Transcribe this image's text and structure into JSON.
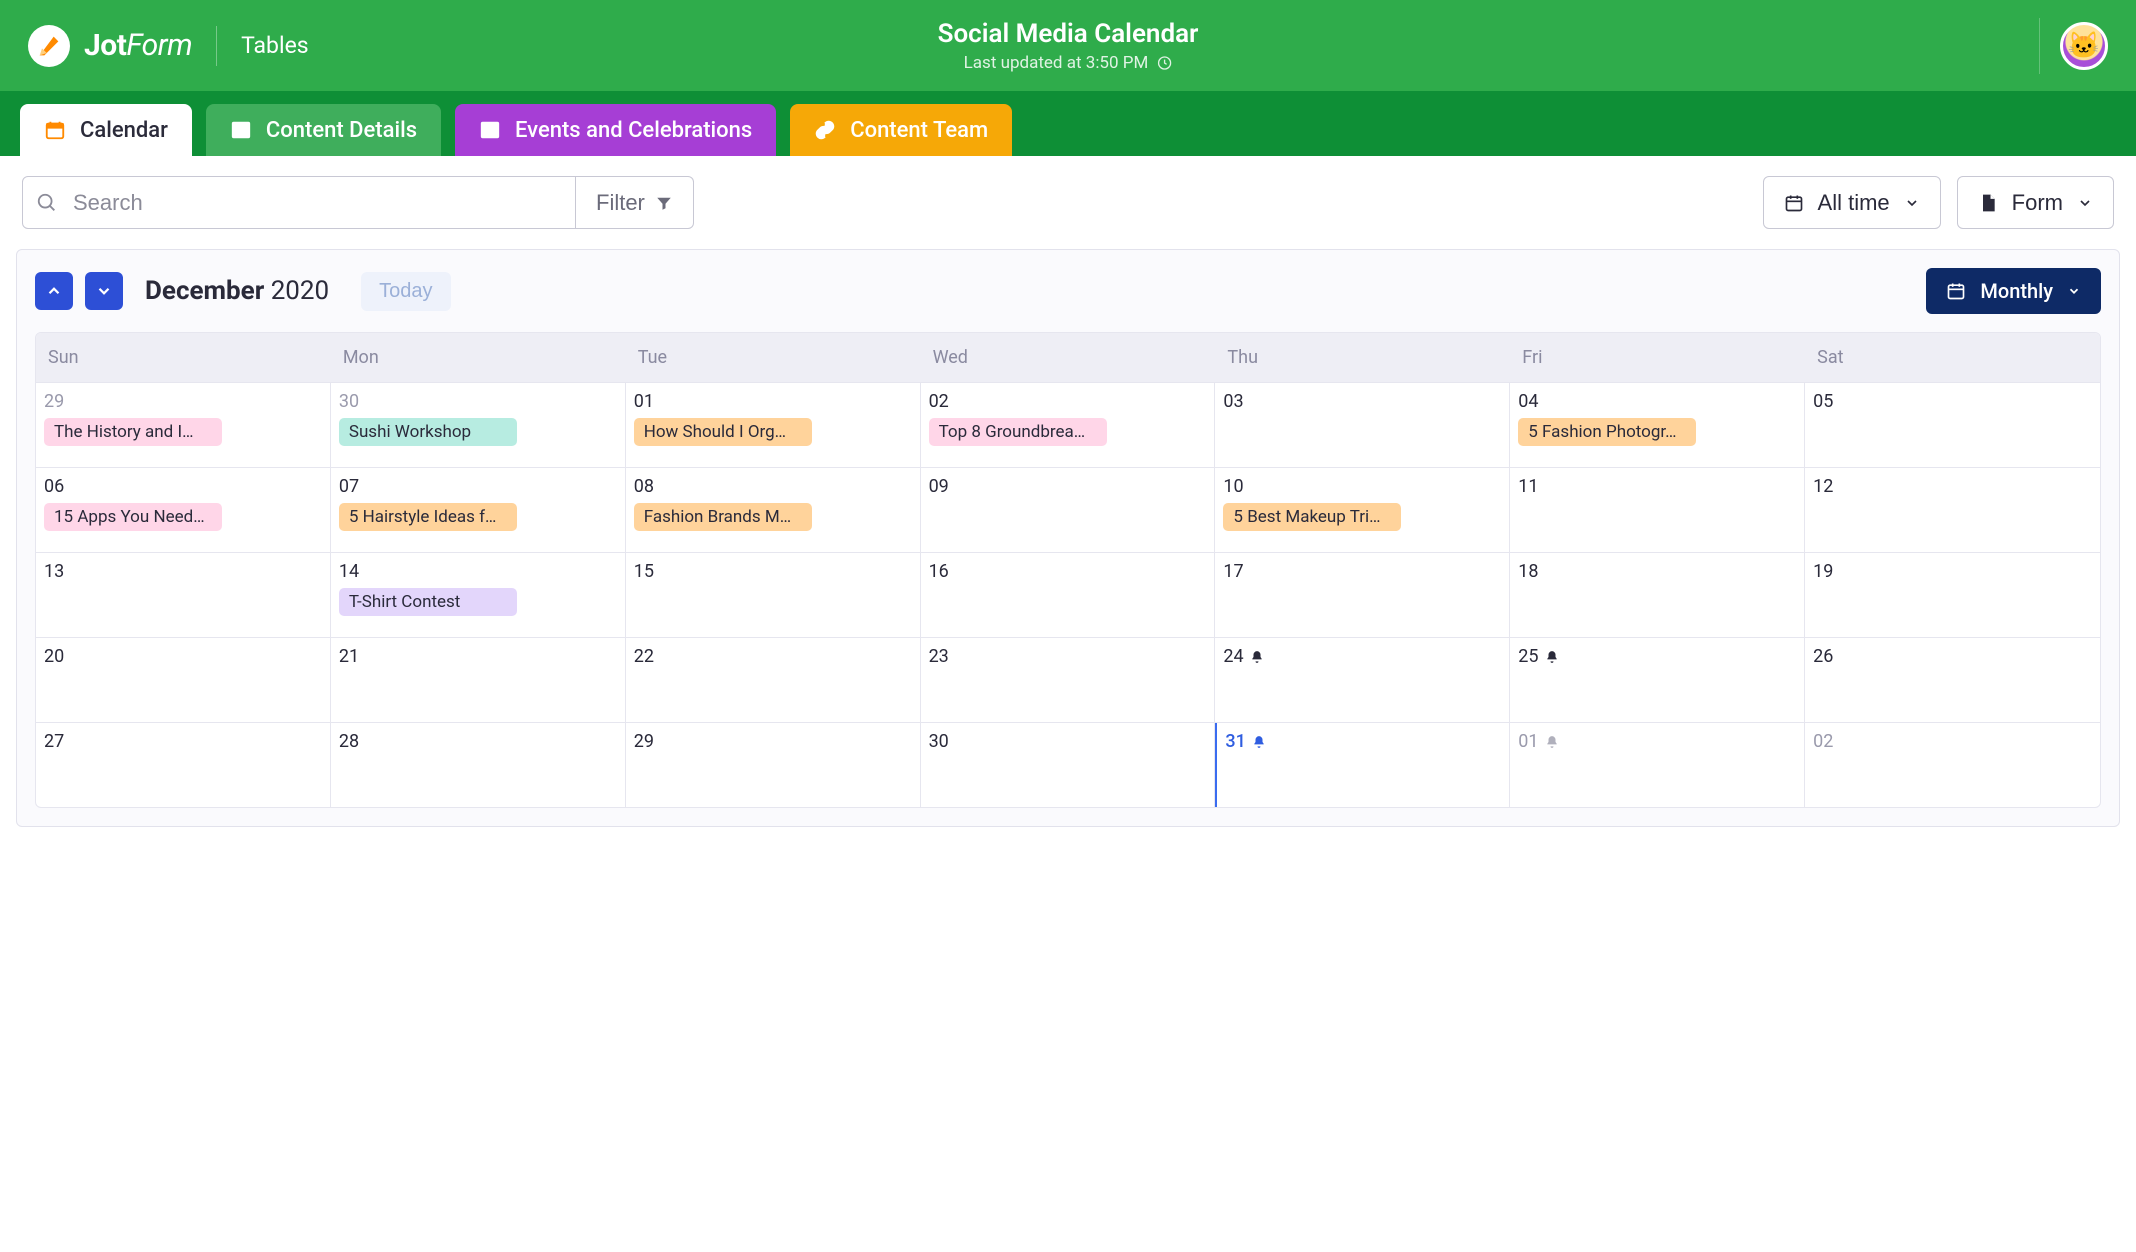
{
  "brand": {
    "name_bold": "Jot",
    "name_light": "Form",
    "section": "Tables"
  },
  "header": {
    "title": "Social Media Calendar",
    "subtitle": "Last updated at 3:50 PM"
  },
  "tabs": [
    {
      "label": "Calendar"
    },
    {
      "label": "Content Details"
    },
    {
      "label": "Events and Celebrations"
    },
    {
      "label": "Content Team"
    }
  ],
  "toolbar": {
    "search_placeholder": "Search",
    "filter_label": "Filter",
    "range_label": "All time",
    "form_label": "Form"
  },
  "calendar": {
    "month": "December",
    "year": "2020",
    "today_label": "Today",
    "view_label": "Monthly",
    "dow": [
      "Sun",
      "Mon",
      "Tue",
      "Wed",
      "Thu",
      "Fri",
      "Sat"
    ],
    "weeks": [
      [
        {
          "num": "29",
          "grey": true,
          "events": [
            {
              "text": "The History and I…",
              "color": "pink"
            }
          ]
        },
        {
          "num": "30",
          "grey": true,
          "events": [
            {
              "text": "Sushi Workshop",
              "color": "teal"
            }
          ]
        },
        {
          "num": "01",
          "events": [
            {
              "text": "How Should I Org…",
              "color": "orange"
            }
          ]
        },
        {
          "num": "02",
          "events": [
            {
              "text": "Top 8 Groundbrea…",
              "color": "pink"
            }
          ]
        },
        {
          "num": "03"
        },
        {
          "num": "04",
          "events": [
            {
              "text": "5 Fashion Photogr…",
              "color": "orange"
            }
          ]
        },
        {
          "num": "05"
        }
      ],
      [
        {
          "num": "06",
          "events": [
            {
              "text": "15 Apps You Need…",
              "color": "pink"
            }
          ]
        },
        {
          "num": "07",
          "events": [
            {
              "text": "5 Hairstyle Ideas f…",
              "color": "orange"
            }
          ]
        },
        {
          "num": "08",
          "events": [
            {
              "text": "Fashion Brands M…",
              "color": "orange"
            }
          ]
        },
        {
          "num": "09"
        },
        {
          "num": "10",
          "events": [
            {
              "text": "5 Best Makeup Tri…",
              "color": "orange"
            }
          ]
        },
        {
          "num": "11"
        },
        {
          "num": "12"
        }
      ],
      [
        {
          "num": "13"
        },
        {
          "num": "14",
          "events": [
            {
              "text": "T-Shirt Contest",
              "color": "lav"
            }
          ]
        },
        {
          "num": "15"
        },
        {
          "num": "16"
        },
        {
          "num": "17"
        },
        {
          "num": "18"
        },
        {
          "num": "19"
        }
      ],
      [
        {
          "num": "20"
        },
        {
          "num": "21"
        },
        {
          "num": "22"
        },
        {
          "num": "23"
        },
        {
          "num": "24",
          "bell": true
        },
        {
          "num": "25",
          "bell": true
        },
        {
          "num": "26"
        }
      ],
      [
        {
          "num": "27"
        },
        {
          "num": "28"
        },
        {
          "num": "29"
        },
        {
          "num": "30"
        },
        {
          "num": "31",
          "bell": true,
          "blue": true,
          "todaycol": true
        },
        {
          "num": "01",
          "grey": true,
          "bell": true,
          "bell_grey": true
        },
        {
          "num": "02",
          "grey": true
        }
      ]
    ]
  }
}
